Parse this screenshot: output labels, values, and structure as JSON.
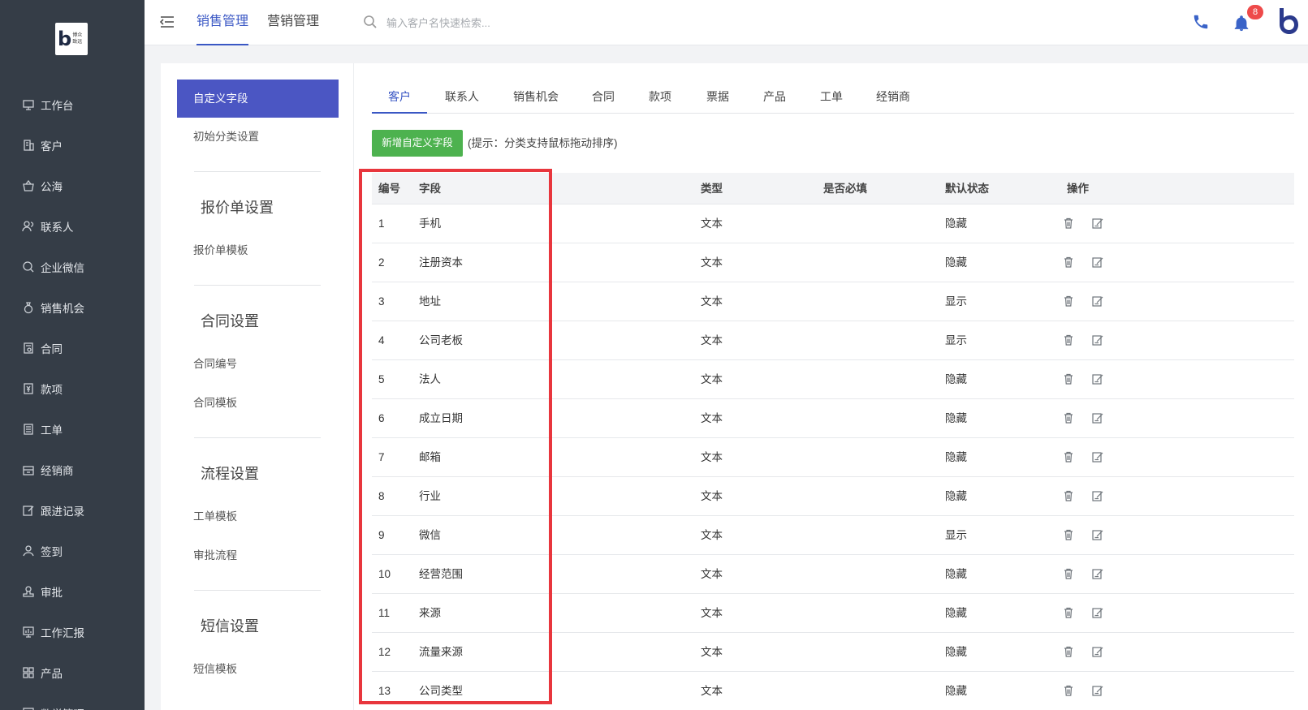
{
  "sidebar": {
    "logo": {
      "letter": "b",
      "line1": "博众",
      "line2": "致远"
    },
    "items": [
      {
        "label": "工作台",
        "icon": "desktop-icon"
      },
      {
        "label": "客户",
        "icon": "building-icon"
      },
      {
        "label": "公海",
        "icon": "basket-icon"
      },
      {
        "label": "联系人",
        "icon": "contacts-icon"
      },
      {
        "label": "企业微信",
        "icon": "chat-icon"
      },
      {
        "label": "销售机会",
        "icon": "moneybag-icon"
      },
      {
        "label": "合同",
        "icon": "contract-icon"
      },
      {
        "label": "款项",
        "icon": "payment-icon"
      },
      {
        "label": "工单",
        "icon": "ticket-icon"
      },
      {
        "label": "经销商",
        "icon": "store-icon"
      },
      {
        "label": "跟进记录",
        "icon": "edit-icon"
      },
      {
        "label": "签到",
        "icon": "checkin-icon"
      },
      {
        "label": "审批",
        "icon": "stamp-icon"
      },
      {
        "label": "工作汇报",
        "icon": "report-icon"
      },
      {
        "label": "产品",
        "icon": "grid-icon"
      },
      {
        "label": "数学管理",
        "icon": "manage-icon"
      }
    ]
  },
  "topbar": {
    "tabs": [
      {
        "label": "销售管理",
        "active": true
      },
      {
        "label": "营销管理",
        "active": false
      }
    ],
    "search": {
      "placeholder": "输入客户名快速检索..."
    },
    "notification_count": "8"
  },
  "subnav": {
    "active": "自定义字段",
    "items": {
      "init": "初始分类设置",
      "quote_head": "报价单设置",
      "quote_tpl": "报价单模板",
      "contract_head": "合同设置",
      "contract_no": "合同编号",
      "contract_tpl": "合同模板",
      "flow_head": "流程设置",
      "ticket_tpl": "工单模板",
      "approval_flow": "审批流程",
      "sms_head": "短信设置",
      "sms_tpl": "短信模板"
    }
  },
  "content_tabs": [
    "客户",
    "联系人",
    "销售机会",
    "合同",
    "款项",
    "票据",
    "产品",
    "工单",
    "经销商"
  ],
  "actions": {
    "add_label": "新增自定义字段",
    "hint": "(提示：分类支持鼠标拖动排序)"
  },
  "table": {
    "headers": {
      "no": "编号",
      "field": "字段",
      "type": "类型",
      "required": "是否必填",
      "default": "默认状态",
      "ops": "操作"
    },
    "rows": [
      {
        "no": "1",
        "field": "手机",
        "type": "文本",
        "required": "",
        "default": "隐藏"
      },
      {
        "no": "2",
        "field": "注册资本",
        "type": "文本",
        "required": "",
        "default": "隐藏"
      },
      {
        "no": "3",
        "field": "地址",
        "type": "文本",
        "required": "",
        "default": "显示"
      },
      {
        "no": "4",
        "field": "公司老板",
        "type": "文本",
        "required": "",
        "default": "显示"
      },
      {
        "no": "5",
        "field": "法人",
        "type": "文本",
        "required": "",
        "default": "隐藏"
      },
      {
        "no": "6",
        "field": "成立日期",
        "type": "文本",
        "required": "",
        "default": "隐藏"
      },
      {
        "no": "7",
        "field": "邮箱",
        "type": "文本",
        "required": "",
        "default": "隐藏"
      },
      {
        "no": "8",
        "field": "行业",
        "type": "文本",
        "required": "",
        "default": "隐藏"
      },
      {
        "no": "9",
        "field": "微信",
        "type": "文本",
        "required": "",
        "default": "显示"
      },
      {
        "no": "10",
        "field": "经营范围",
        "type": "文本",
        "required": "",
        "default": "隐藏"
      },
      {
        "no": "11",
        "field": "来源",
        "type": "文本",
        "required": "",
        "default": "隐藏"
      },
      {
        "no": "12",
        "field": "流量来源",
        "type": "文本",
        "required": "",
        "default": "隐藏"
      },
      {
        "no": "13",
        "field": "公司类型",
        "type": "文本",
        "required": "",
        "default": "隐藏"
      }
    ]
  },
  "colors": {
    "sidebar_bg": "#353d47",
    "accent": "#3a57c4",
    "active_sub": "#4b56c3",
    "add_button": "#4db24f",
    "highlight": "#e8363d",
    "badge": "#ee4a4a"
  }
}
